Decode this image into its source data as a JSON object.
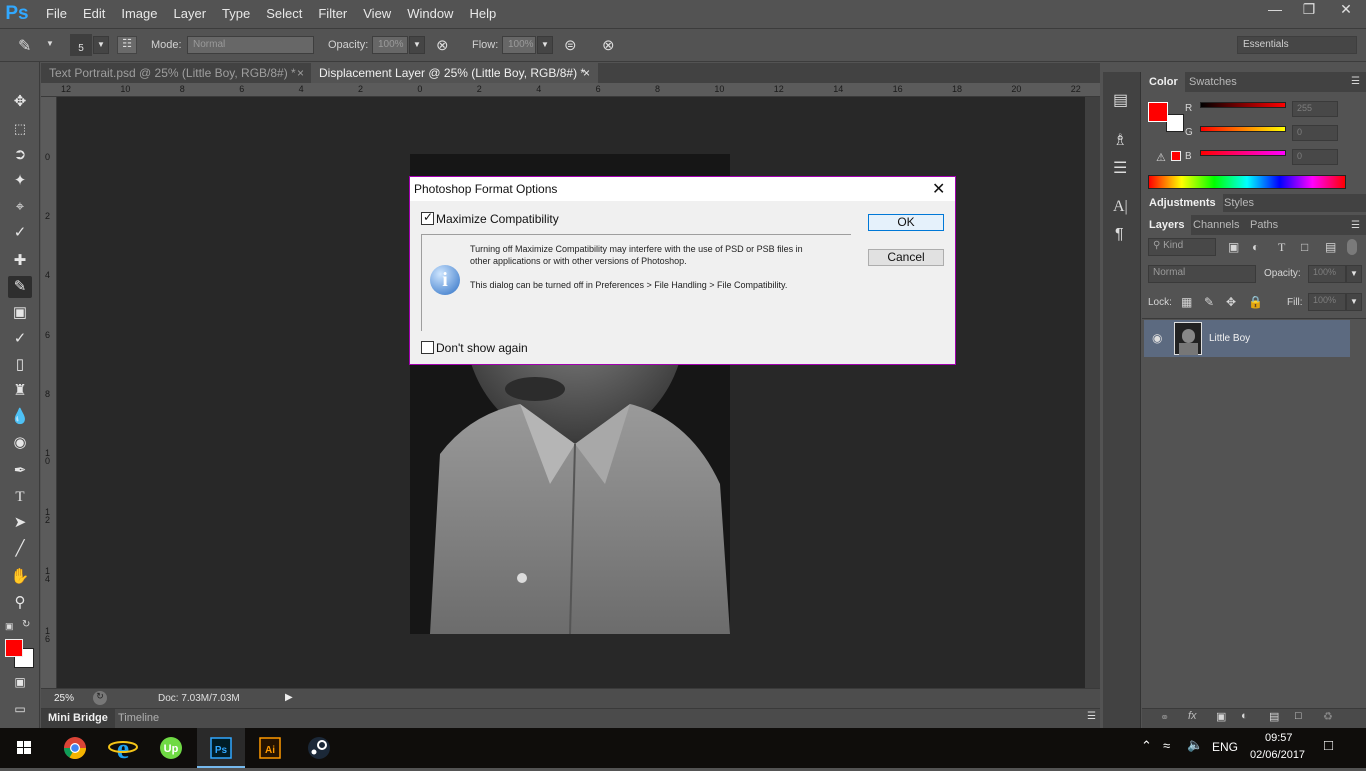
{
  "app": {
    "logo": "Ps"
  },
  "menubar": {
    "items": [
      "File",
      "Edit",
      "Image",
      "Layer",
      "Type",
      "Select",
      "Filter",
      "View",
      "Window",
      "Help"
    ]
  },
  "window_controls": {
    "minimize_icon": "minimize-icon",
    "restore_icon": "restore-icon",
    "close_icon": "close-icon"
  },
  "options_bar": {
    "brush_size": "5",
    "mode_label": "Mode:",
    "mode_value": "Normal",
    "opacity_label": "Opacity:",
    "opacity_value": "100%",
    "flow_label": "Flow:",
    "flow_value": "100%",
    "workspace": "Essentials"
  },
  "document_tabs": [
    {
      "title": "Text Portrait.psd @ 25% (Little Boy, RGB/8#) *",
      "active": false
    },
    {
      "title": "Displacement Layer @ 25% (Little Boy, RGB/8#) *",
      "active": true
    }
  ],
  "rulers": {
    "horizontal": [
      "12",
      "10",
      "8",
      "6",
      "4",
      "2",
      "0",
      "2",
      "4",
      "6",
      "8",
      "10",
      "12",
      "14",
      "16",
      "18",
      "20",
      "22"
    ],
    "vertical": [
      "0",
      "2",
      "4",
      "6",
      "8",
      "1\n0",
      "1\n2",
      "1\n4",
      "1\n6"
    ]
  },
  "status": {
    "zoom": "25%",
    "doc": "Doc: 7.03M/7.03M"
  },
  "bottom_tabs": [
    "Mini Bridge",
    "Timeline"
  ],
  "color_panel": {
    "tabs": [
      "Color",
      "Swatches"
    ],
    "foreground": "#ff0000",
    "background": "#ffffff",
    "channels": [
      {
        "label": "R",
        "value": "255"
      },
      {
        "label": "G",
        "value": "0"
      },
      {
        "label": "B",
        "value": "0"
      }
    ]
  },
  "adjustments_tabs": [
    "Adjustments",
    "Styles"
  ],
  "layers_panel": {
    "tabs": [
      "Layers",
      "Channels",
      "Paths"
    ],
    "filter_kind": "Kind",
    "blend_mode": "Normal",
    "opacity_label": "Opacity:",
    "opacity_value": "100%",
    "lock_label": "Lock:",
    "fill_label": "Fill:",
    "fill_value": "100%",
    "layers": [
      {
        "name": "Little Boy",
        "visible": true
      }
    ]
  },
  "dialog": {
    "title": "Photoshop Format Options",
    "maximize_label": "Maximize Compatibility",
    "maximize_checked": true,
    "message_line1": "Turning off Maximize Compatibility may interfere with the use of PSD or PSB files in",
    "message_line2": " other applications or with other versions of Photoshop.",
    "message_line3": "This dialog can be turned off in Preferences > File Handling > File Compatibility.",
    "dont_show_label": "Don't show again",
    "dont_show_checked": false,
    "ok_label": "OK",
    "cancel_label": "Cancel"
  },
  "taskbar": {
    "apps": [
      "chrome-icon",
      "ie-icon",
      "upwork-icon",
      "photoshop-icon",
      "illustrator-icon",
      "steam-icon"
    ],
    "lang": "ENG",
    "time": "09:57",
    "date": "02/06/2017"
  }
}
